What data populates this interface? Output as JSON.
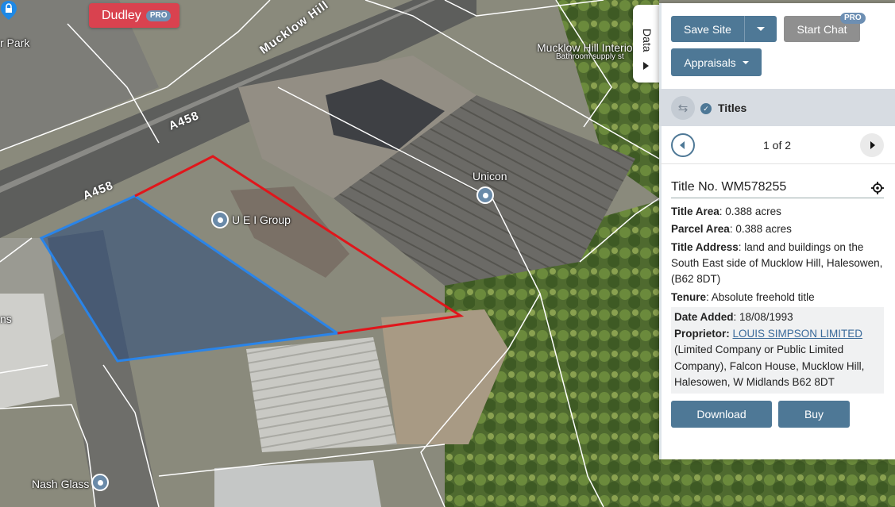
{
  "map": {
    "region_badge": "Dudley",
    "region_badge_pro": "PRO",
    "road_labels": [
      "Mucklow Hill",
      "A458",
      "A458"
    ],
    "poi_labels": {
      "ueigroup": "U E I Group",
      "unicon": "Unicon",
      "nash": "Nash Glass",
      "mucklow_bathroom": "Mucklow Hill Interio",
      "mucklow_bathroom2": "Bathroom supply st",
      "carpark": "r Park",
      "edge_left": "ns"
    },
    "colors": {
      "parcel_outline": "#e0161b",
      "title_fill": "#2a4a7a",
      "title_outline": "#2a84e8",
      "boundary_lines": "#ffffff"
    }
  },
  "data_tab": {
    "label": "Data"
  },
  "panel": {
    "save_site": "Save Site",
    "start_chat": "Start Chat",
    "start_chat_pro": "PRO",
    "appraisals": "Appraisals",
    "titles_header": "Titles",
    "pager": "1 of 2",
    "title_no": "Title No. WM578255",
    "title_area_label": "Title Area",
    "title_area_value": ": 0.388 acres",
    "parcel_area_label": "Parcel Area",
    "parcel_area_value": ": 0.388 acres",
    "title_address_label": "Title Address",
    "title_address_value": ": land and buildings on the South East side of Mucklow Hill, Halesowen, (B62 8DT)",
    "tenure_label": "Tenure",
    "tenure_value": ": Absolute freehold title",
    "date_added_label": "Date Added",
    "date_added_value": ": 18/08/1993",
    "proprietor_label": "Proprietor",
    "proprietor_name": "LOUIS SIMPSON LIMITED",
    "proprietor_details": "(Limited Company or Public Limited Company), Falcon House, Mucklow Hill, Halesowen, W Midlands B62 8DT",
    "download": "Download",
    "buy": "Buy"
  },
  "colors": {
    "button_primary": "#4e7896",
    "button_disabled": "#8f8f8f",
    "badge_red": "#d9424f",
    "pro_blue": "#6d8fb3"
  }
}
